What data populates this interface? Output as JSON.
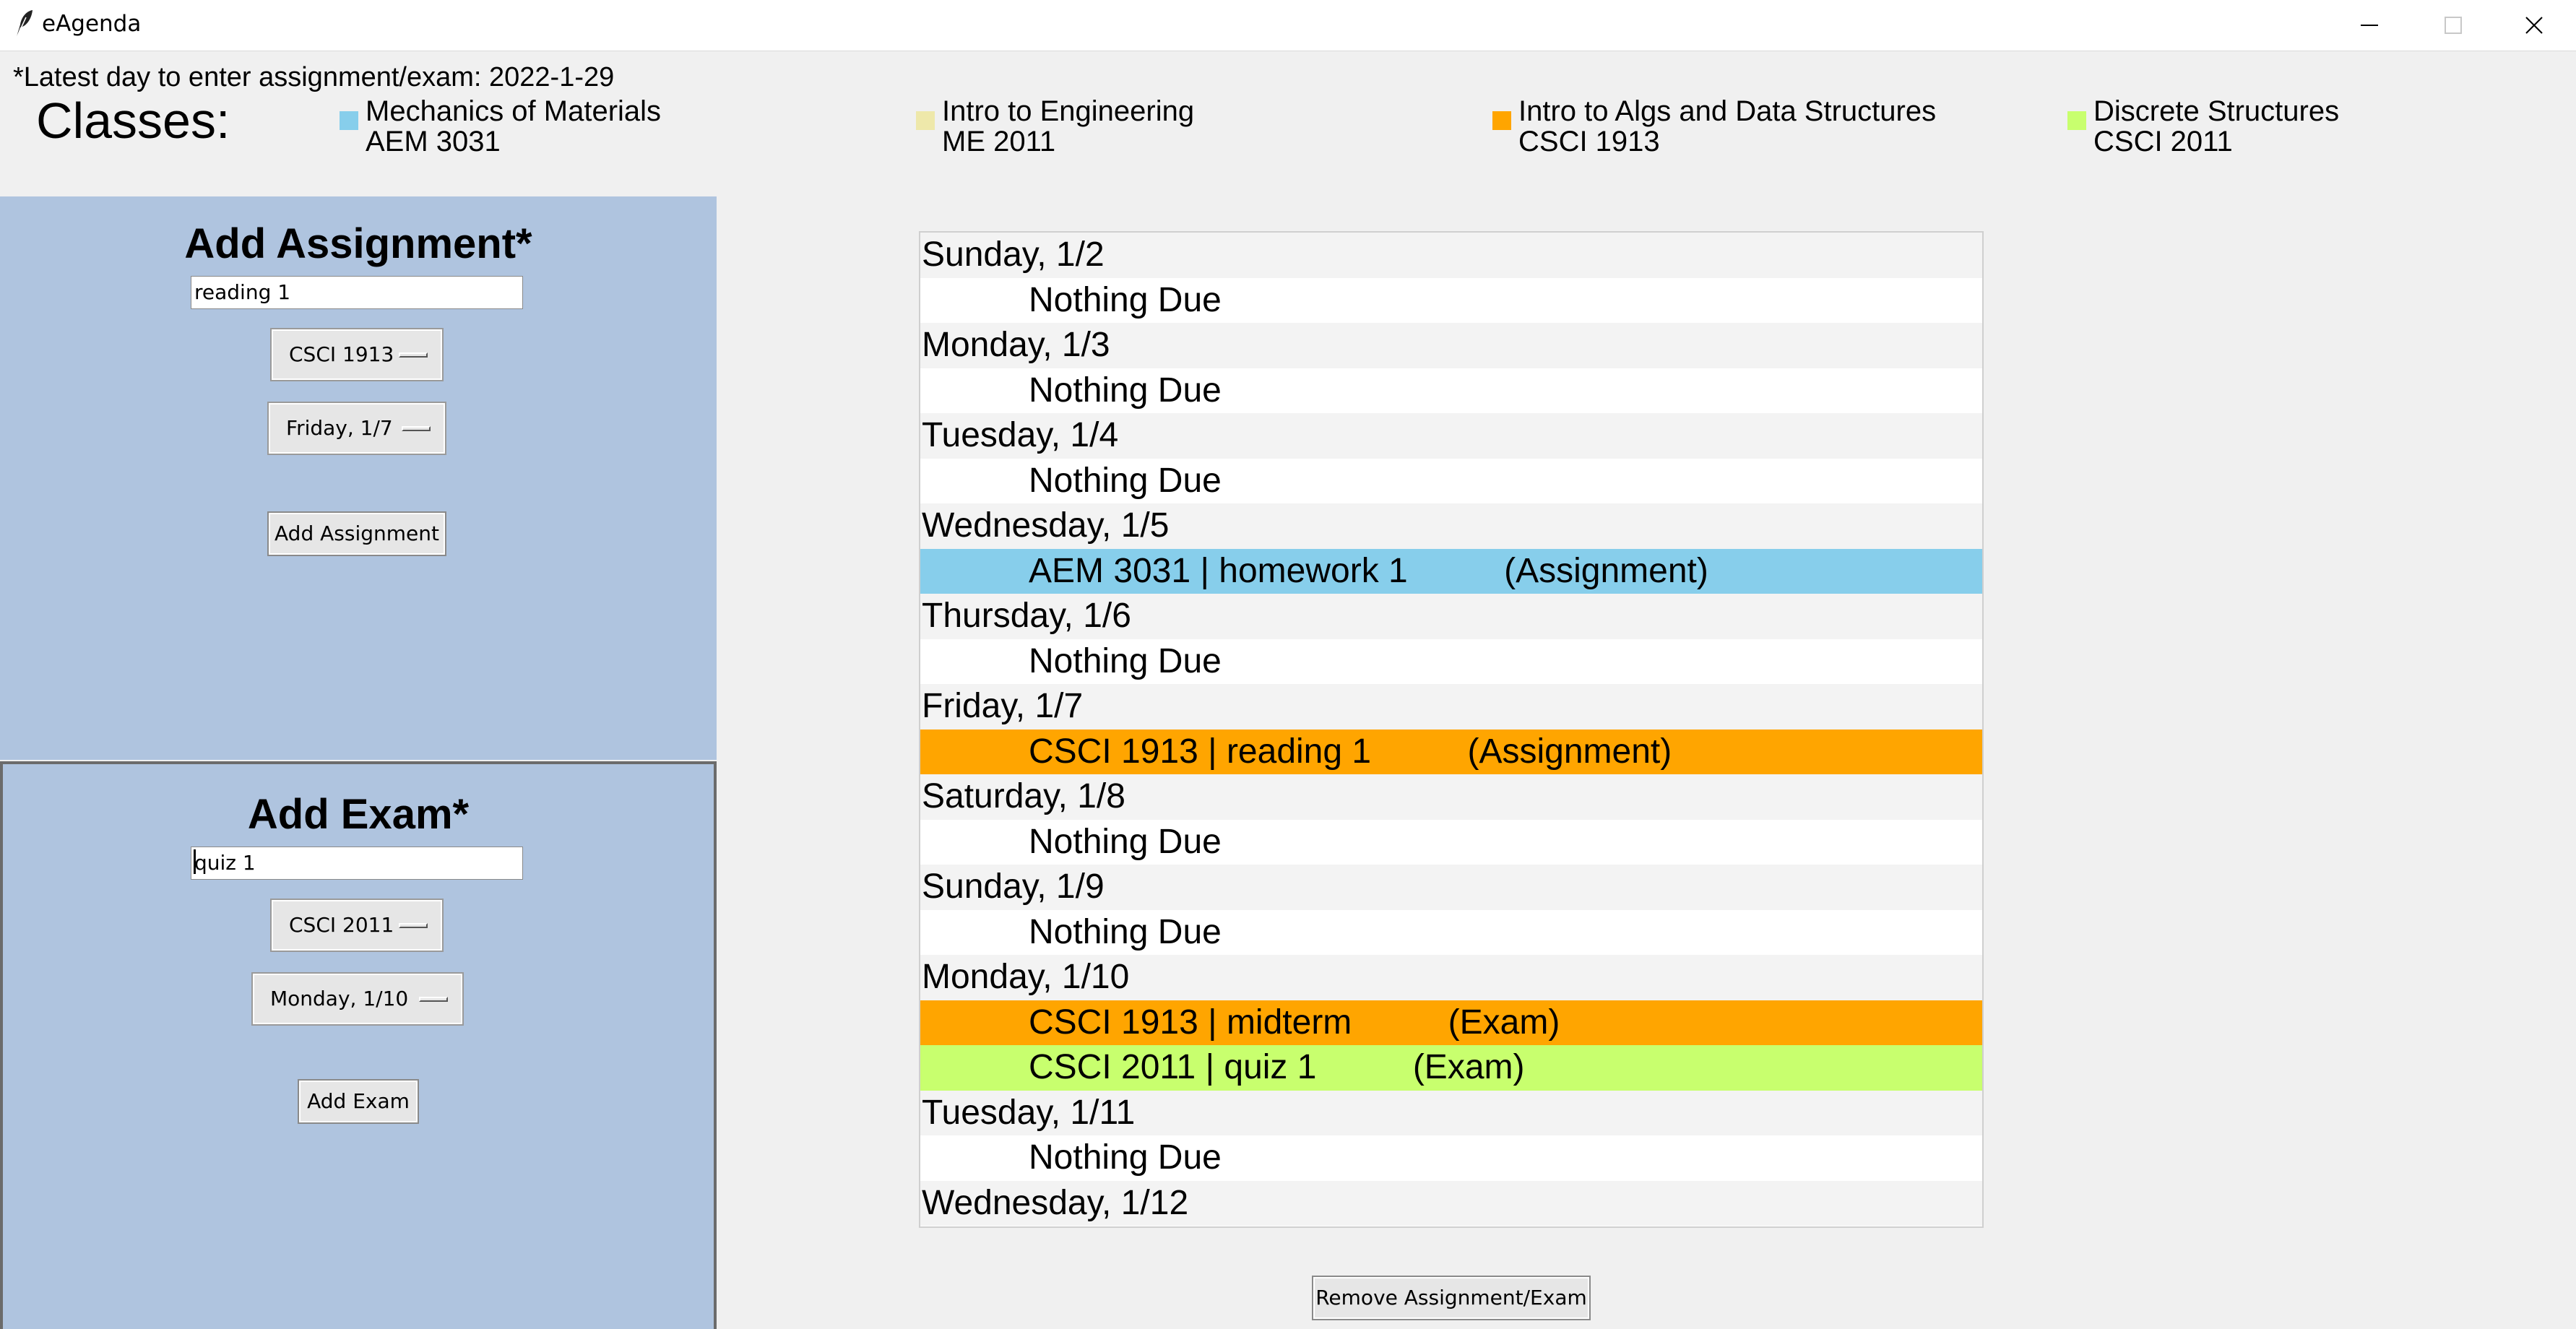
{
  "window": {
    "title": "eAgenda",
    "icon": "feather-icon",
    "controls": [
      "minimize-icon",
      "maximize-icon",
      "close-icon"
    ]
  },
  "header": {
    "latest_note": "*Latest day to enter assignment/exam: 2022-1-29",
    "classes_label": "Classes:",
    "classes": [
      {
        "name": "Mechanics of Materials",
        "code": "AEM 3031",
        "color": "#87ceeb"
      },
      {
        "name": "Intro to Engineering",
        "code": "ME 2011",
        "color": "#eee8aa"
      },
      {
        "name": "Intro to Algs and Data Structures",
        "code": "CSCI 1913",
        "color": "#ffa500"
      },
      {
        "name": "Discrete Structures",
        "code": "CSCI 2011",
        "color": "#c8ff6e"
      }
    ]
  },
  "add_assignment": {
    "title": "Add Assignment*",
    "name_value": "reading 1",
    "class_selected": "CSCI 1913",
    "date_selected": "Friday, 1/7",
    "button": "Add Assignment"
  },
  "add_exam": {
    "title": "Add Exam*",
    "name_value": "quiz 1",
    "class_selected": "CSCI 2011",
    "date_selected": "Monday, 1/10",
    "button": "Add Exam"
  },
  "agenda": {
    "rows": [
      {
        "kind": "day",
        "text": "Sunday, 1/2"
      },
      {
        "kind": "item",
        "text": "Nothing Due"
      },
      {
        "kind": "day",
        "text": "Monday, 1/3"
      },
      {
        "kind": "item",
        "text": "Nothing Due"
      },
      {
        "kind": "day",
        "text": "Tuesday, 1/4"
      },
      {
        "kind": "item",
        "text": "Nothing Due"
      },
      {
        "kind": "day",
        "text": "Wednesday, 1/5"
      },
      {
        "kind": "item",
        "text": "AEM 3031 | homework 1          (Assignment)",
        "color": "#87ceeb"
      },
      {
        "kind": "day",
        "text": "Thursday, 1/6"
      },
      {
        "kind": "item",
        "text": "Nothing Due"
      },
      {
        "kind": "day",
        "text": "Friday, 1/7"
      },
      {
        "kind": "item",
        "text": "CSCI 1913 | reading 1          (Assignment)",
        "color": "#ffa500"
      },
      {
        "kind": "day",
        "text": "Saturday, 1/8"
      },
      {
        "kind": "item",
        "text": "Nothing Due"
      },
      {
        "kind": "day",
        "text": "Sunday, 1/9"
      },
      {
        "kind": "item",
        "text": "Nothing Due"
      },
      {
        "kind": "day",
        "text": "Monday, 1/10"
      },
      {
        "kind": "item",
        "text": "CSCI 1913 | midterm          (Exam)",
        "color": "#ffa500"
      },
      {
        "kind": "item",
        "text": "CSCI 2011 | quiz 1          (Exam)",
        "color": "#c8ff6e"
      },
      {
        "kind": "day",
        "text": "Tuesday, 1/11"
      },
      {
        "kind": "item",
        "text": "Nothing Due"
      },
      {
        "kind": "day",
        "text": "Wednesday, 1/12"
      }
    ],
    "remove_button": "Remove Assignment/Exam"
  }
}
